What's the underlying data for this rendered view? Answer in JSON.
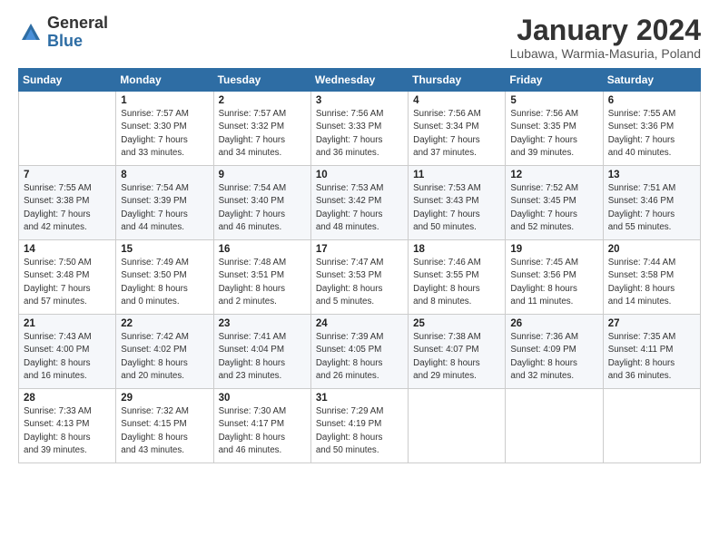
{
  "logo": {
    "general": "General",
    "blue": "Blue"
  },
  "header": {
    "month_title": "January 2024",
    "location": "Lubawa, Warmia-Masuria, Poland"
  },
  "weekdays": [
    "Sunday",
    "Monday",
    "Tuesday",
    "Wednesday",
    "Thursday",
    "Friday",
    "Saturday"
  ],
  "weeks": [
    [
      {
        "day": "",
        "info": ""
      },
      {
        "day": "1",
        "info": "Sunrise: 7:57 AM\nSunset: 3:30 PM\nDaylight: 7 hours\nand 33 minutes."
      },
      {
        "day": "2",
        "info": "Sunrise: 7:57 AM\nSunset: 3:32 PM\nDaylight: 7 hours\nand 34 minutes."
      },
      {
        "day": "3",
        "info": "Sunrise: 7:56 AM\nSunset: 3:33 PM\nDaylight: 7 hours\nand 36 minutes."
      },
      {
        "day": "4",
        "info": "Sunrise: 7:56 AM\nSunset: 3:34 PM\nDaylight: 7 hours\nand 37 minutes."
      },
      {
        "day": "5",
        "info": "Sunrise: 7:56 AM\nSunset: 3:35 PM\nDaylight: 7 hours\nand 39 minutes."
      },
      {
        "day": "6",
        "info": "Sunrise: 7:55 AM\nSunset: 3:36 PM\nDaylight: 7 hours\nand 40 minutes."
      }
    ],
    [
      {
        "day": "7",
        "info": "Sunrise: 7:55 AM\nSunset: 3:38 PM\nDaylight: 7 hours\nand 42 minutes."
      },
      {
        "day": "8",
        "info": "Sunrise: 7:54 AM\nSunset: 3:39 PM\nDaylight: 7 hours\nand 44 minutes."
      },
      {
        "day": "9",
        "info": "Sunrise: 7:54 AM\nSunset: 3:40 PM\nDaylight: 7 hours\nand 46 minutes."
      },
      {
        "day": "10",
        "info": "Sunrise: 7:53 AM\nSunset: 3:42 PM\nDaylight: 7 hours\nand 48 minutes."
      },
      {
        "day": "11",
        "info": "Sunrise: 7:53 AM\nSunset: 3:43 PM\nDaylight: 7 hours\nand 50 minutes."
      },
      {
        "day": "12",
        "info": "Sunrise: 7:52 AM\nSunset: 3:45 PM\nDaylight: 7 hours\nand 52 minutes."
      },
      {
        "day": "13",
        "info": "Sunrise: 7:51 AM\nSunset: 3:46 PM\nDaylight: 7 hours\nand 55 minutes."
      }
    ],
    [
      {
        "day": "14",
        "info": "Sunrise: 7:50 AM\nSunset: 3:48 PM\nDaylight: 7 hours\nand 57 minutes."
      },
      {
        "day": "15",
        "info": "Sunrise: 7:49 AM\nSunset: 3:50 PM\nDaylight: 8 hours\nand 0 minutes."
      },
      {
        "day": "16",
        "info": "Sunrise: 7:48 AM\nSunset: 3:51 PM\nDaylight: 8 hours\nand 2 minutes."
      },
      {
        "day": "17",
        "info": "Sunrise: 7:47 AM\nSunset: 3:53 PM\nDaylight: 8 hours\nand 5 minutes."
      },
      {
        "day": "18",
        "info": "Sunrise: 7:46 AM\nSunset: 3:55 PM\nDaylight: 8 hours\nand 8 minutes."
      },
      {
        "day": "19",
        "info": "Sunrise: 7:45 AM\nSunset: 3:56 PM\nDaylight: 8 hours\nand 11 minutes."
      },
      {
        "day": "20",
        "info": "Sunrise: 7:44 AM\nSunset: 3:58 PM\nDaylight: 8 hours\nand 14 minutes."
      }
    ],
    [
      {
        "day": "21",
        "info": "Sunrise: 7:43 AM\nSunset: 4:00 PM\nDaylight: 8 hours\nand 16 minutes."
      },
      {
        "day": "22",
        "info": "Sunrise: 7:42 AM\nSunset: 4:02 PM\nDaylight: 8 hours\nand 20 minutes."
      },
      {
        "day": "23",
        "info": "Sunrise: 7:41 AM\nSunset: 4:04 PM\nDaylight: 8 hours\nand 23 minutes."
      },
      {
        "day": "24",
        "info": "Sunrise: 7:39 AM\nSunset: 4:05 PM\nDaylight: 8 hours\nand 26 minutes."
      },
      {
        "day": "25",
        "info": "Sunrise: 7:38 AM\nSunset: 4:07 PM\nDaylight: 8 hours\nand 29 minutes."
      },
      {
        "day": "26",
        "info": "Sunrise: 7:36 AM\nSunset: 4:09 PM\nDaylight: 8 hours\nand 32 minutes."
      },
      {
        "day": "27",
        "info": "Sunrise: 7:35 AM\nSunset: 4:11 PM\nDaylight: 8 hours\nand 36 minutes."
      }
    ],
    [
      {
        "day": "28",
        "info": "Sunrise: 7:33 AM\nSunset: 4:13 PM\nDaylight: 8 hours\nand 39 minutes."
      },
      {
        "day": "29",
        "info": "Sunrise: 7:32 AM\nSunset: 4:15 PM\nDaylight: 8 hours\nand 43 minutes."
      },
      {
        "day": "30",
        "info": "Sunrise: 7:30 AM\nSunset: 4:17 PM\nDaylight: 8 hours\nand 46 minutes."
      },
      {
        "day": "31",
        "info": "Sunrise: 7:29 AM\nSunset: 4:19 PM\nDaylight: 8 hours\nand 50 minutes."
      },
      {
        "day": "",
        "info": ""
      },
      {
        "day": "",
        "info": ""
      },
      {
        "day": "",
        "info": ""
      }
    ]
  ]
}
